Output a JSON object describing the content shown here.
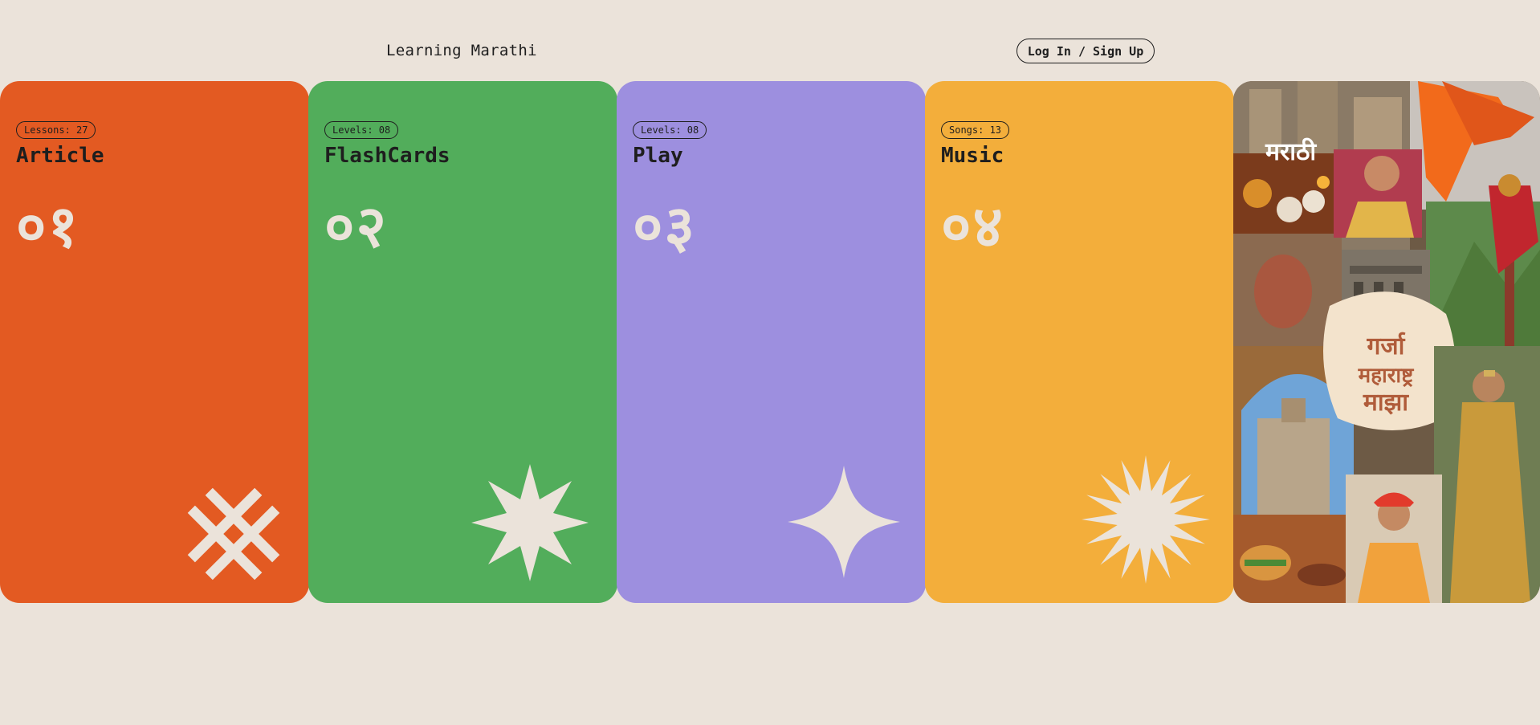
{
  "header": {
    "site_title": "Learning Marathi",
    "auth_button": "Log In / Sign Up"
  },
  "cards": [
    {
      "badge": "Lessons: 27",
      "title": "Article",
      "number": "०१",
      "color": "#e35a22",
      "icon": "hashtag-cross-icon"
    },
    {
      "badge": "Levels: 08",
      "title": "FlashCards",
      "number": "०२",
      "color": "#52ad5b",
      "icon": "eight-point-star-icon"
    },
    {
      "badge": "Levels: 08",
      "title": "Play",
      "number": "०३",
      "color": "#9d8fdf",
      "icon": "four-point-sparkle-icon"
    },
    {
      "badge": "Songs: 13",
      "title": "Music",
      "number": "०४",
      "color": "#f3ae3b",
      "icon": "sunburst-star-icon"
    }
  ],
  "collage": {
    "label": "मराठी",
    "lettering": "गर्जा महाराष्ट्र माझा"
  },
  "colors": {
    "background": "#ebe3da",
    "text": "#1e1e1e",
    "shape_fill": "#ebe3da"
  }
}
